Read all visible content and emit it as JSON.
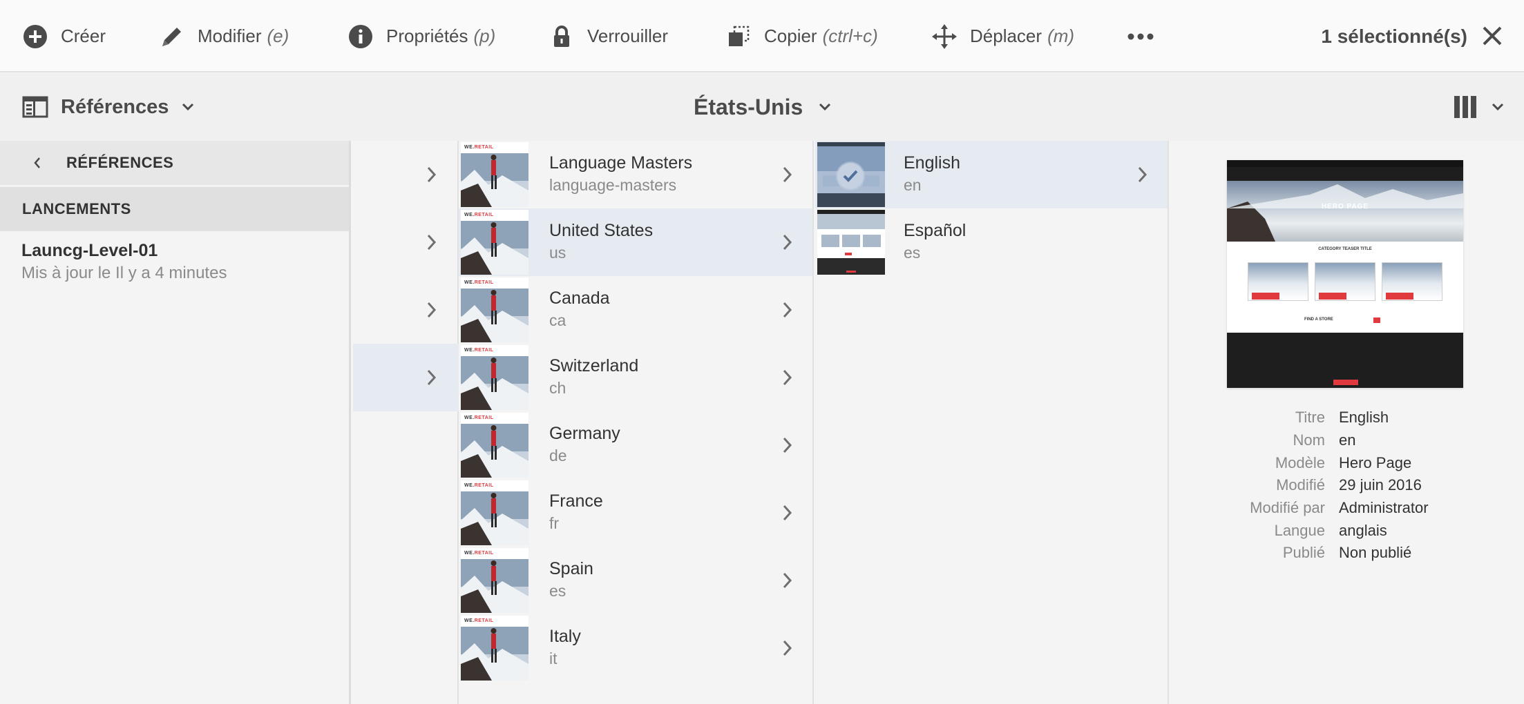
{
  "actionbar": {
    "create_label": "Créer",
    "edit_label": "Modifier",
    "edit_shortcut": "(e)",
    "properties_label": "Propriétés",
    "properties_shortcut": "(p)",
    "lock_label": "Verrouiller",
    "copy_label": "Copier",
    "copy_shortcut": "(ctrl+c)",
    "move_label": "Déplacer",
    "move_shortcut": "(m)",
    "more_icon": "more-icon",
    "selection_count": "1 sélectionné(s)",
    "close_icon": "close-icon"
  },
  "toolbar": {
    "rail_label": "Références",
    "title": "États-Unis",
    "view_icon": "column-view-icon"
  },
  "rail": {
    "back_label": "RÉFÉRENCES",
    "section_label": "LANCEMENTS",
    "items": [
      {
        "title": "Launcg-Level-01",
        "subtitle": "Mis à jour le Il y a 4 minutes"
      }
    ]
  },
  "column2": {
    "thumb_logo_a": "WE.",
    "thumb_logo_b": "RETAIL",
    "rows": [
      {
        "title": "Language Masters",
        "name": "language-masters"
      },
      {
        "title": "United States",
        "name": "us",
        "active": true
      },
      {
        "title": "Canada",
        "name": "ca"
      },
      {
        "title": "Switzerland",
        "name": "ch"
      },
      {
        "title": "Germany",
        "name": "de"
      },
      {
        "title": "France",
        "name": "fr"
      },
      {
        "title": "Spain",
        "name": "es"
      },
      {
        "title": "Italy",
        "name": "it"
      }
    ]
  },
  "column3": {
    "rows": [
      {
        "title": "English",
        "name": "en",
        "selected": true
      },
      {
        "title": "Español",
        "name": "es"
      }
    ]
  },
  "preview": {
    "hero_title": "HERO PAGE",
    "teaser_title": "CATEGORY TEASER TITLE",
    "find_store": "FIND A STORE",
    "meta": [
      {
        "label": "Titre",
        "value": "English"
      },
      {
        "label": "Nom",
        "value": "en"
      },
      {
        "label": "Modèle",
        "value": "Hero Page"
      },
      {
        "label": "Modifié",
        "value": "29 juin 2016"
      },
      {
        "label": "Modifié par",
        "value": "Administrator"
      },
      {
        "label": "Langue",
        "value": "anglais"
      },
      {
        "label": "Publié",
        "value": "Non publié"
      }
    ]
  },
  "colors": {
    "accent_selected": "#e6eaf1",
    "brand_red": "#e03a3e",
    "text": "#4b4b4b"
  }
}
